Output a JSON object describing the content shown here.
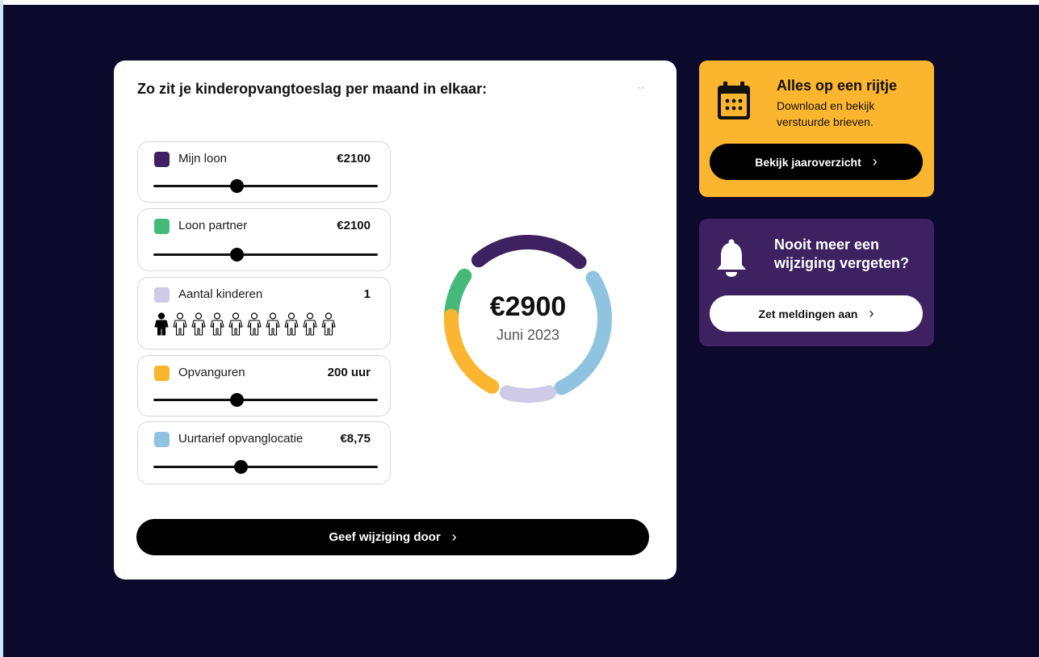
{
  "main": {
    "title": "Zo zit je kinderopvangtoeslag per maand in elkaar:",
    "more": "··",
    "controls": [
      {
        "label": "Mijn loon",
        "value": "€2100",
        "color": "#3d2160",
        "level": 0.37
      },
      {
        "label": "Loon partner",
        "value": "€2100",
        "color": "#44b97a",
        "level": 0.37
      },
      {
        "label": "Aantal kinderen",
        "value": "1",
        "color": "#cfcbe6",
        "selected_children": 1,
        "max_children": 10
      },
      {
        "label": "Opvanguren",
        "value": "200 uur",
        "color": "#fbb52f",
        "level": 0.37
      },
      {
        "label": "Uurtarief opvanglocatie",
        "value": "€8,75",
        "color": "#90c3e0",
        "level": 0.39
      }
    ],
    "donut": {
      "amount": "€2900",
      "date": "Juni 2023",
      "segments": [
        {
          "color": "#44b97a"
        },
        {
          "color": "#3d2160"
        },
        {
          "color": "#90c3e0"
        },
        {
          "color": "#cfcbe6"
        },
        {
          "color": "#fbb52f"
        }
      ]
    },
    "submit_label": "Geef wijziging door",
    "chevron": "›"
  },
  "overview_card": {
    "icon": "calendar-icon",
    "title": "Alles op een rijtje",
    "desc_line1": "Download en bekijk",
    "desc_line2": "verstuurde brieven.",
    "button_label": "Bekijk jaaroverzicht",
    "chevron": "›",
    "color": "#fbb52f"
  },
  "notify_card": {
    "icon": "bell-icon",
    "title_line1": "Nooit meer een",
    "title_line2": "wijziging vergeten?",
    "button_label": "Zet meldingen aan",
    "chevron": "›",
    "color": "#3d2160"
  }
}
